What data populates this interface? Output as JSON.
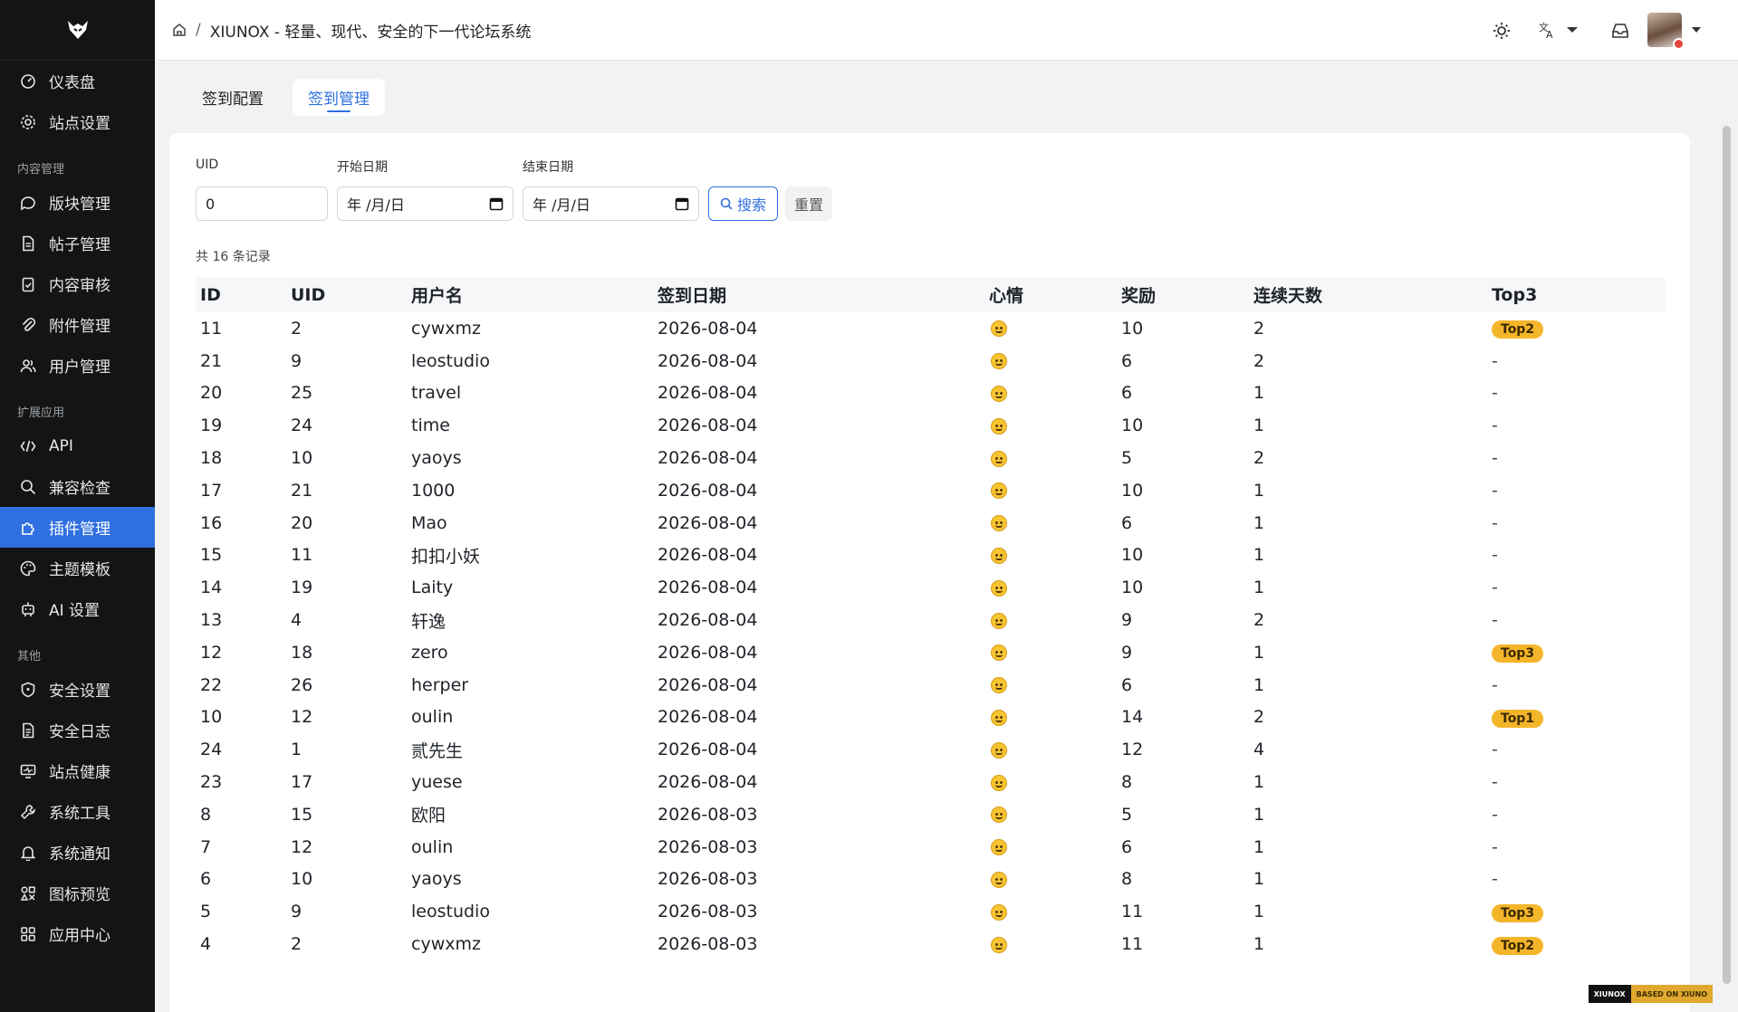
{
  "header": {
    "breadcrumb_title": "XIUNOX - 轻量、现代、安全的下一代论坛系统"
  },
  "sidebar": {
    "top_items": [
      {
        "label": "仪表盘",
        "icon": "dashboard-icon"
      },
      {
        "label": "站点设置",
        "icon": "gear-icon"
      }
    ],
    "groups": [
      {
        "title": "内容管理",
        "items": [
          {
            "label": "版块管理",
            "icon": "chat-bubble-icon"
          },
          {
            "label": "帖子管理",
            "icon": "document-icon"
          },
          {
            "label": "内容审核",
            "icon": "clipboard-check-icon"
          },
          {
            "label": "附件管理",
            "icon": "paperclip-icon"
          },
          {
            "label": "用户管理",
            "icon": "users-icon"
          }
        ]
      },
      {
        "title": "扩展应用",
        "items": [
          {
            "label": "API",
            "icon": "code-icon"
          },
          {
            "label": "兼容检查",
            "icon": "search-icon"
          },
          {
            "label": "插件管理",
            "icon": "puzzle-icon",
            "active": true
          },
          {
            "label": "主题模板",
            "icon": "palette-icon"
          },
          {
            "label": "AI 设置",
            "icon": "robot-icon"
          }
        ]
      },
      {
        "title": "其他",
        "items": [
          {
            "label": "安全设置",
            "icon": "shield-icon"
          },
          {
            "label": "安全日志",
            "icon": "log-icon"
          },
          {
            "label": "站点健康",
            "icon": "monitor-icon"
          },
          {
            "label": "系统工具",
            "icon": "wrench-icon"
          },
          {
            "label": "系统通知",
            "icon": "bell-icon"
          },
          {
            "label": "图标预览",
            "icon": "icons-grid-icon"
          },
          {
            "label": "应用中心",
            "icon": "apps-icon"
          }
        ]
      }
    ]
  },
  "tabs": [
    {
      "label": "签到配置",
      "active": false
    },
    {
      "label": "签到管理",
      "active": true
    }
  ],
  "filters": {
    "uid_label": "UID",
    "uid_value": "0",
    "start_label": "开始日期",
    "start_value": "年 /月/日",
    "end_label": "结束日期",
    "end_value": "年 /月/日",
    "search_label": "搜索",
    "reset_label": "重置"
  },
  "total_text": "共 16 条记录",
  "table": {
    "columns": [
      "ID",
      "UID",
      "用户名",
      "签到日期",
      "心情",
      "奖励",
      "连续天数",
      "Top3"
    ],
    "rows": [
      {
        "id": "11",
        "uid": "2",
        "username": "cywxmz",
        "date": "2026-08-04",
        "reward": "10",
        "streak": "2",
        "top3": "Top2"
      },
      {
        "id": "21",
        "uid": "9",
        "username": "leostudio",
        "date": "2026-08-04",
        "reward": "6",
        "streak": "2",
        "top3": "-"
      },
      {
        "id": "20",
        "uid": "25",
        "username": "travel",
        "date": "2026-08-04",
        "reward": "6",
        "streak": "1",
        "top3": "-"
      },
      {
        "id": "19",
        "uid": "24",
        "username": "time",
        "date": "2026-08-04",
        "reward": "10",
        "streak": "1",
        "top3": "-"
      },
      {
        "id": "18",
        "uid": "10",
        "username": "yaoys",
        "date": "2026-08-04",
        "reward": "5",
        "streak": "2",
        "top3": "-"
      },
      {
        "id": "17",
        "uid": "21",
        "username": "1000",
        "date": "2026-08-04",
        "reward": "10",
        "streak": "1",
        "top3": "-"
      },
      {
        "id": "16",
        "uid": "20",
        "username": "Mao",
        "date": "2026-08-04",
        "reward": "6",
        "streak": "1",
        "top3": "-"
      },
      {
        "id": "15",
        "uid": "11",
        "username": "扣扣小妖",
        "date": "2026-08-04",
        "reward": "10",
        "streak": "1",
        "top3": "-"
      },
      {
        "id": "14",
        "uid": "19",
        "username": "Laity",
        "date": "2026-08-04",
        "reward": "10",
        "streak": "1",
        "top3": "-"
      },
      {
        "id": "13",
        "uid": "4",
        "username": "轩逸",
        "date": "2026-08-04",
        "reward": "9",
        "streak": "2",
        "top3": "-"
      },
      {
        "id": "12",
        "uid": "18",
        "username": "zero",
        "date": "2026-08-04",
        "reward": "9",
        "streak": "1",
        "top3": "Top3"
      },
      {
        "id": "22",
        "uid": "26",
        "username": "herper",
        "date": "2026-08-04",
        "reward": "6",
        "streak": "1",
        "top3": "-"
      },
      {
        "id": "10",
        "uid": "12",
        "username": "oulin",
        "date": "2026-08-04",
        "reward": "14",
        "streak": "2",
        "top3": "Top1"
      },
      {
        "id": "24",
        "uid": "1",
        "username": "贰先生",
        "date": "2026-08-04",
        "reward": "12",
        "streak": "4",
        "top3": "-"
      },
      {
        "id": "23",
        "uid": "17",
        "username": "yuese",
        "date": "2026-08-04",
        "reward": "8",
        "streak": "1",
        "top3": "-"
      },
      {
        "id": "8",
        "uid": "15",
        "username": "欧阳",
        "date": "2026-08-03",
        "reward": "5",
        "streak": "1",
        "top3": "-"
      },
      {
        "id": "7",
        "uid": "12",
        "username": "oulin",
        "date": "2026-08-03",
        "reward": "6",
        "streak": "1",
        "top3": "-"
      },
      {
        "id": "6",
        "uid": "10",
        "username": "yaoys",
        "date": "2026-08-03",
        "reward": "8",
        "streak": "1",
        "top3": "-"
      },
      {
        "id": "5",
        "uid": "9",
        "username": "leostudio",
        "date": "2026-08-03",
        "reward": "11",
        "streak": "1",
        "top3": "Top3"
      },
      {
        "id": "4",
        "uid": "2",
        "username": "cywxmz",
        "date": "2026-08-03",
        "reward": "11",
        "streak": "1",
        "top3": "Top2"
      }
    ]
  },
  "footer_badge": {
    "left": "XIUNOX",
    "right": "BASED ON XIUNO"
  },
  "colors": {
    "accent": "#2f6fe0",
    "sidebar_bg": "#141414",
    "badge": "#f5b52a"
  }
}
